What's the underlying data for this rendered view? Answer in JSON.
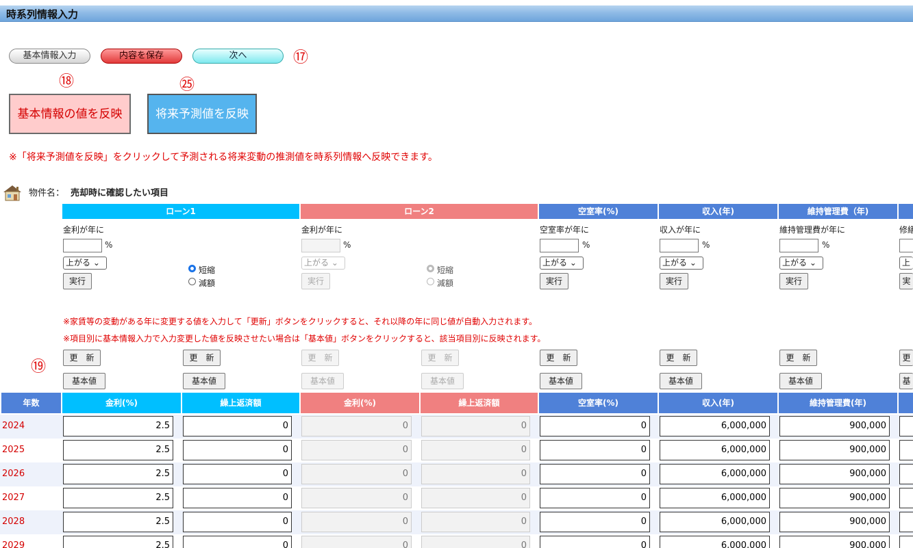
{
  "page_title": "時系列情報入力",
  "nav": {
    "basic_info": "基本情報入力",
    "save": "内容を保存",
    "next": "次へ"
  },
  "markers": {
    "m17": "⑰",
    "m18": "⑱",
    "m25": "㉕",
    "m19": "⑲"
  },
  "actions": {
    "reflect_basic": "基本情報の値を反映",
    "reflect_forecast": "将来予測値を反映"
  },
  "notice_forecast": "※「将来予測値を反映」をクリックして予測される将来変動の推測値を時系列情報へ反映できます。",
  "property": {
    "label": "物件名：",
    "name": "売却時に確認したい項目"
  },
  "groups": [
    {
      "title": "ローン1",
      "prompt": "金利が年に",
      "pct": "%",
      "select": "上がる",
      "run": "実行",
      "radio1": "短縮",
      "radio2": "減額"
    },
    {
      "title": "ローン2",
      "prompt": "金利が年に",
      "pct": "%",
      "select": "上がる",
      "run": "実行",
      "radio1": "短縮",
      "radio2": "減額"
    },
    {
      "title": "空室率(%)",
      "prompt": "空室率が年に",
      "pct": "%",
      "select": "上がる",
      "run": "実行"
    },
    {
      "title": "収入(年)",
      "prompt": "収入が年に",
      "pct": "%",
      "select": "上がる",
      "run": "実行"
    },
    {
      "title": "維持管理費（年)",
      "prompt": "維持管理費が年に",
      "pct": "%",
      "select": "上がる",
      "run": "実行"
    },
    {
      "title": "",
      "prompt": "修繕",
      "select": "上",
      "run": "実"
    }
  ],
  "notes": [
    "※家賃等の変動がある年に変更する値を入力して「更新」ボタンをクリックすると、それ以降の年に同じ値が自動入力されます。",
    "※項目別に基本情報入力で入力変更した値を反映させたい場合は「基本値」ボタンをクリックすると、該当項目別に反映されます。"
  ],
  "buttons": {
    "update": "更　新",
    "base": "基本値",
    "update_cut": "更",
    "base_cut": "基"
  },
  "table": {
    "headers": [
      "年数",
      "金利(%)",
      "繰上返済額",
      "金利(%)",
      "繰上返済額",
      "空室率(%)",
      "収入(年)",
      "維持管理費(年)"
    ],
    "rows": [
      {
        "year": "2024",
        "rate1": "2.5",
        "prepay1": "0",
        "rate2": "0",
        "prepay2": "0",
        "vacancy": "0",
        "income": "6,000,000",
        "maint": "900,000"
      },
      {
        "year": "2025",
        "rate1": "2.5",
        "prepay1": "0",
        "rate2": "0",
        "prepay2": "0",
        "vacancy": "0",
        "income": "6,000,000",
        "maint": "900,000"
      },
      {
        "year": "2026",
        "rate1": "2.5",
        "prepay1": "0",
        "rate2": "0",
        "prepay2": "0",
        "vacancy": "0",
        "income": "6,000,000",
        "maint": "900,000"
      },
      {
        "year": "2027",
        "rate1": "2.5",
        "prepay1": "0",
        "rate2": "0",
        "prepay2": "0",
        "vacancy": "0",
        "income": "6,000,000",
        "maint": "900,000"
      },
      {
        "year": "2028",
        "rate1": "2.5",
        "prepay1": "0",
        "rate2": "0",
        "prepay2": "0",
        "vacancy": "0",
        "income": "6,000,000",
        "maint": "900,000"
      },
      {
        "year": "2029",
        "rate1": "2.5",
        "prepay1": "0",
        "rate2": "0",
        "prepay2": "0",
        "vacancy": "0",
        "income": "6,000,000",
        "maint": "900,000"
      }
    ]
  },
  "colors": {
    "loan1": "#00bfff",
    "loan2": "#f08080",
    "other": "#4f81d8",
    "accent_red": "#e00000"
  }
}
